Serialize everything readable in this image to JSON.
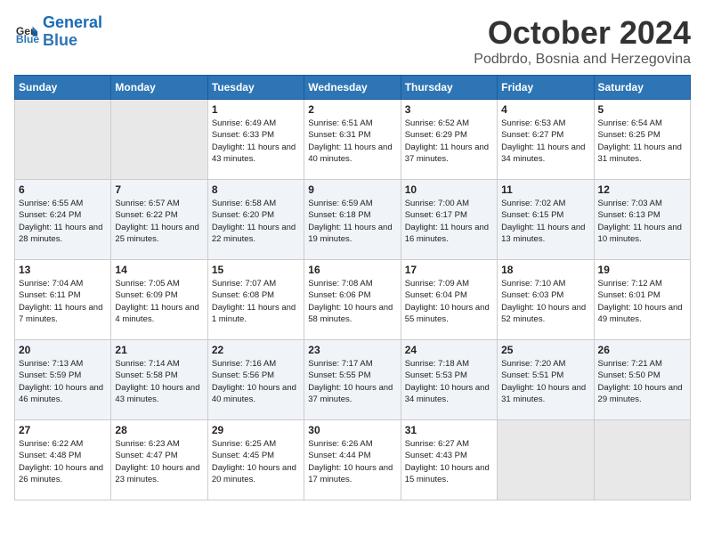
{
  "logo": {
    "line1": "General",
    "line2": "Blue"
  },
  "title": "October 2024",
  "location": "Podbrdo, Bosnia and Herzegovina",
  "weekdays": [
    "Sunday",
    "Monday",
    "Tuesday",
    "Wednesday",
    "Thursday",
    "Friday",
    "Saturday"
  ],
  "weeks": [
    [
      {
        "day": "",
        "sunrise": "",
        "sunset": "",
        "daylight": ""
      },
      {
        "day": "",
        "sunrise": "",
        "sunset": "",
        "daylight": ""
      },
      {
        "day": "1",
        "sunrise": "Sunrise: 6:49 AM",
        "sunset": "Sunset: 6:33 PM",
        "daylight": "Daylight: 11 hours and 43 minutes."
      },
      {
        "day": "2",
        "sunrise": "Sunrise: 6:51 AM",
        "sunset": "Sunset: 6:31 PM",
        "daylight": "Daylight: 11 hours and 40 minutes."
      },
      {
        "day": "3",
        "sunrise": "Sunrise: 6:52 AM",
        "sunset": "Sunset: 6:29 PM",
        "daylight": "Daylight: 11 hours and 37 minutes."
      },
      {
        "day": "4",
        "sunrise": "Sunrise: 6:53 AM",
        "sunset": "Sunset: 6:27 PM",
        "daylight": "Daylight: 11 hours and 34 minutes."
      },
      {
        "day": "5",
        "sunrise": "Sunrise: 6:54 AM",
        "sunset": "Sunset: 6:25 PM",
        "daylight": "Daylight: 11 hours and 31 minutes."
      }
    ],
    [
      {
        "day": "6",
        "sunrise": "Sunrise: 6:55 AM",
        "sunset": "Sunset: 6:24 PM",
        "daylight": "Daylight: 11 hours and 28 minutes."
      },
      {
        "day": "7",
        "sunrise": "Sunrise: 6:57 AM",
        "sunset": "Sunset: 6:22 PM",
        "daylight": "Daylight: 11 hours and 25 minutes."
      },
      {
        "day": "8",
        "sunrise": "Sunrise: 6:58 AM",
        "sunset": "Sunset: 6:20 PM",
        "daylight": "Daylight: 11 hours and 22 minutes."
      },
      {
        "day": "9",
        "sunrise": "Sunrise: 6:59 AM",
        "sunset": "Sunset: 6:18 PM",
        "daylight": "Daylight: 11 hours and 19 minutes."
      },
      {
        "day": "10",
        "sunrise": "Sunrise: 7:00 AM",
        "sunset": "Sunset: 6:17 PM",
        "daylight": "Daylight: 11 hours and 16 minutes."
      },
      {
        "day": "11",
        "sunrise": "Sunrise: 7:02 AM",
        "sunset": "Sunset: 6:15 PM",
        "daylight": "Daylight: 11 hours and 13 minutes."
      },
      {
        "day": "12",
        "sunrise": "Sunrise: 7:03 AM",
        "sunset": "Sunset: 6:13 PM",
        "daylight": "Daylight: 11 hours and 10 minutes."
      }
    ],
    [
      {
        "day": "13",
        "sunrise": "Sunrise: 7:04 AM",
        "sunset": "Sunset: 6:11 PM",
        "daylight": "Daylight: 11 hours and 7 minutes."
      },
      {
        "day": "14",
        "sunrise": "Sunrise: 7:05 AM",
        "sunset": "Sunset: 6:09 PM",
        "daylight": "Daylight: 11 hours and 4 minutes."
      },
      {
        "day": "15",
        "sunrise": "Sunrise: 7:07 AM",
        "sunset": "Sunset: 6:08 PM",
        "daylight": "Daylight: 11 hours and 1 minute."
      },
      {
        "day": "16",
        "sunrise": "Sunrise: 7:08 AM",
        "sunset": "Sunset: 6:06 PM",
        "daylight": "Daylight: 10 hours and 58 minutes."
      },
      {
        "day": "17",
        "sunrise": "Sunrise: 7:09 AM",
        "sunset": "Sunset: 6:04 PM",
        "daylight": "Daylight: 10 hours and 55 minutes."
      },
      {
        "day": "18",
        "sunrise": "Sunrise: 7:10 AM",
        "sunset": "Sunset: 6:03 PM",
        "daylight": "Daylight: 10 hours and 52 minutes."
      },
      {
        "day": "19",
        "sunrise": "Sunrise: 7:12 AM",
        "sunset": "Sunset: 6:01 PM",
        "daylight": "Daylight: 10 hours and 49 minutes."
      }
    ],
    [
      {
        "day": "20",
        "sunrise": "Sunrise: 7:13 AM",
        "sunset": "Sunset: 5:59 PM",
        "daylight": "Daylight: 10 hours and 46 minutes."
      },
      {
        "day": "21",
        "sunrise": "Sunrise: 7:14 AM",
        "sunset": "Sunset: 5:58 PM",
        "daylight": "Daylight: 10 hours and 43 minutes."
      },
      {
        "day": "22",
        "sunrise": "Sunrise: 7:16 AM",
        "sunset": "Sunset: 5:56 PM",
        "daylight": "Daylight: 10 hours and 40 minutes."
      },
      {
        "day": "23",
        "sunrise": "Sunrise: 7:17 AM",
        "sunset": "Sunset: 5:55 PM",
        "daylight": "Daylight: 10 hours and 37 minutes."
      },
      {
        "day": "24",
        "sunrise": "Sunrise: 7:18 AM",
        "sunset": "Sunset: 5:53 PM",
        "daylight": "Daylight: 10 hours and 34 minutes."
      },
      {
        "day": "25",
        "sunrise": "Sunrise: 7:20 AM",
        "sunset": "Sunset: 5:51 PM",
        "daylight": "Daylight: 10 hours and 31 minutes."
      },
      {
        "day": "26",
        "sunrise": "Sunrise: 7:21 AM",
        "sunset": "Sunset: 5:50 PM",
        "daylight": "Daylight: 10 hours and 29 minutes."
      }
    ],
    [
      {
        "day": "27",
        "sunrise": "Sunrise: 6:22 AM",
        "sunset": "Sunset: 4:48 PM",
        "daylight": "Daylight: 10 hours and 26 minutes."
      },
      {
        "day": "28",
        "sunrise": "Sunrise: 6:23 AM",
        "sunset": "Sunset: 4:47 PM",
        "daylight": "Daylight: 10 hours and 23 minutes."
      },
      {
        "day": "29",
        "sunrise": "Sunrise: 6:25 AM",
        "sunset": "Sunset: 4:45 PM",
        "daylight": "Daylight: 10 hours and 20 minutes."
      },
      {
        "day": "30",
        "sunrise": "Sunrise: 6:26 AM",
        "sunset": "Sunset: 4:44 PM",
        "daylight": "Daylight: 10 hours and 17 minutes."
      },
      {
        "day": "31",
        "sunrise": "Sunrise: 6:27 AM",
        "sunset": "Sunset: 4:43 PM",
        "daylight": "Daylight: 10 hours and 15 minutes."
      },
      {
        "day": "",
        "sunrise": "",
        "sunset": "",
        "daylight": ""
      },
      {
        "day": "",
        "sunrise": "",
        "sunset": "",
        "daylight": ""
      }
    ]
  ]
}
